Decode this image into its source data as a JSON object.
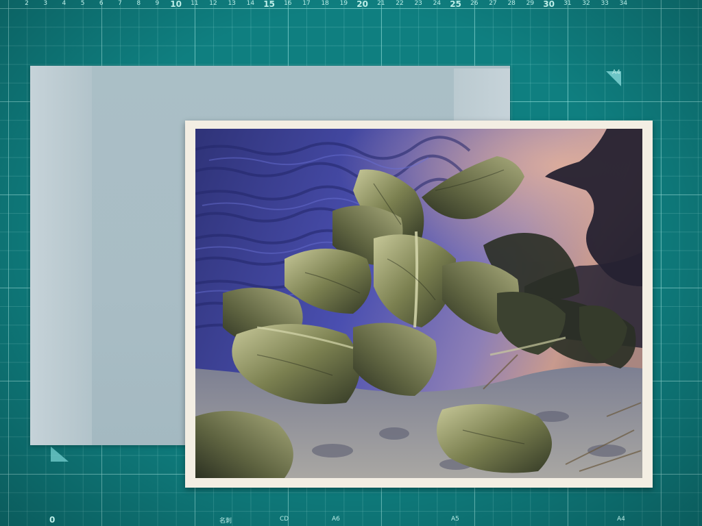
{
  "scene": {
    "description_type": "photograph of a photographic print on a cutting mat",
    "mat_color": "#0f7f80",
    "grid_color": "#96e1dc",
    "print_border_color": "#f3eee3",
    "sleeve_color": "#aabfc6"
  },
  "ruler": {
    "marks": [
      {
        "label": "2",
        "big": false
      },
      {
        "label": "3",
        "big": false
      },
      {
        "label": "4",
        "big": false
      },
      {
        "label": "5",
        "big": false
      },
      {
        "label": "6",
        "big": false
      },
      {
        "label": "7",
        "big": false
      },
      {
        "label": "8",
        "big": false
      },
      {
        "label": "9",
        "big": false
      },
      {
        "label": "10",
        "big": true
      },
      {
        "label": "11",
        "big": false
      },
      {
        "label": "12",
        "big": false
      },
      {
        "label": "13",
        "big": false
      },
      {
        "label": "14",
        "big": false
      },
      {
        "label": "15",
        "big": true
      },
      {
        "label": "16",
        "big": false
      },
      {
        "label": "17",
        "big": false
      },
      {
        "label": "18",
        "big": false
      },
      {
        "label": "19",
        "big": false
      },
      {
        "label": "20",
        "big": true
      },
      {
        "label": "21",
        "big": false
      },
      {
        "label": "22",
        "big": false
      },
      {
        "label": "23",
        "big": false
      },
      {
        "label": "24",
        "big": false
      },
      {
        "label": "25",
        "big": true
      },
      {
        "label": "26",
        "big": false
      },
      {
        "label": "27",
        "big": false
      },
      {
        "label": "28",
        "big": false
      },
      {
        "label": "29",
        "big": false
      },
      {
        "label": "30",
        "big": true
      },
      {
        "label": "31",
        "big": false
      },
      {
        "label": "32",
        "big": false
      },
      {
        "label": "33",
        "big": false
      },
      {
        "label": "34",
        "big": false
      }
    ]
  },
  "mat_labels": {
    "a4_top": "A4",
    "bottom_meishi": "名刺",
    "bottom_cd": "CD",
    "bottom_a6": "A6",
    "bottom_a5": "A5",
    "bottom_a4": "A4",
    "bottom_zero": "0"
  },
  "photo": {
    "subject": "leafy plant at waterside at dusk",
    "palette": {
      "water_dark": "#2f3378",
      "water_mid": "#4a4fb0",
      "water_glow": "#c89a8e",
      "leaf_light": "#b7b98a",
      "leaf_mid": "#6f7445",
      "leaf_dark": "#2f3524",
      "ground": "#8e8f95"
    }
  }
}
